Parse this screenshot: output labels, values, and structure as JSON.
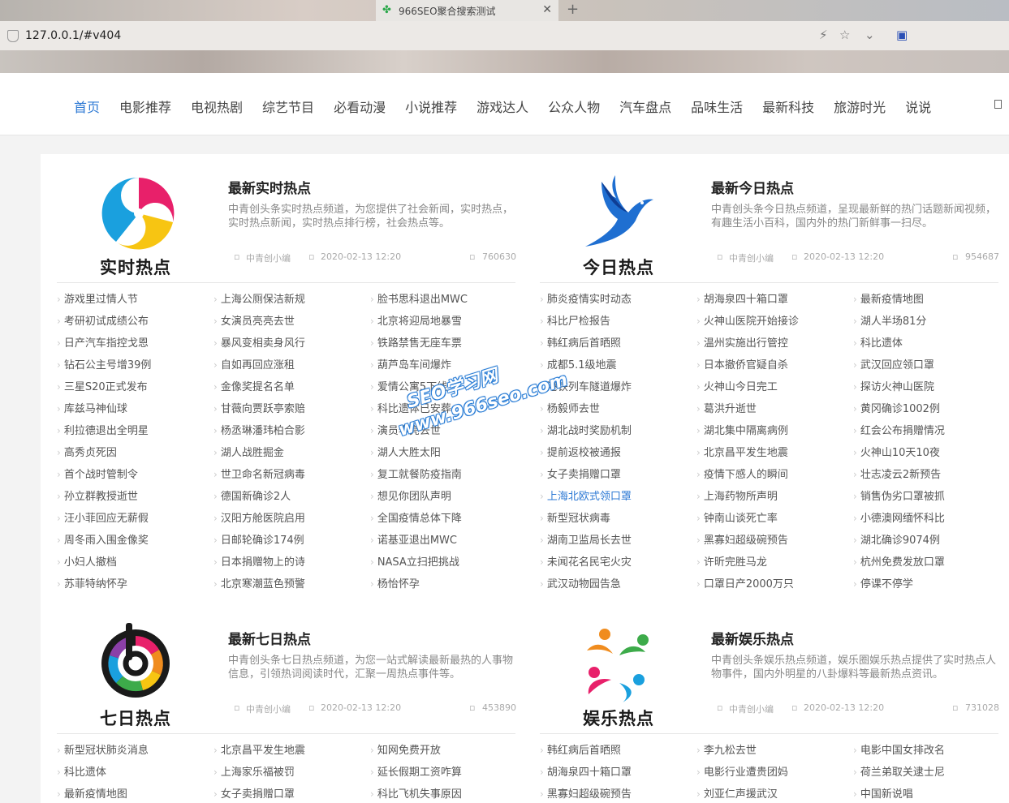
{
  "browser": {
    "tab_title": "966SEO聚合搜索测试",
    "url": "127.0.0.1/#v404"
  },
  "nav": {
    "items": [
      "首页",
      "电影推荐",
      "电视热剧",
      "综艺节目",
      "必看动漫",
      "小说推荐",
      "游戏达人",
      "公众人物",
      "汽车盘点",
      "品味生活",
      "最新科技",
      "旅游时光",
      "说说"
    ],
    "active": "首页"
  },
  "watermark": [
    "SEO学习网",
    "www.966seo.com"
  ],
  "blocks": [
    {
      "logo_text": "实时热点",
      "title": "最新实时热点",
      "desc": "中青创头条实时热点频道，为您提供了社会新闻，实时热点，实时热点新闻，实时热点排行榜，社会热点等。",
      "author": "中青创小编",
      "date": "2020-02-13 12:20",
      "views": "760630",
      "links": [
        [
          "游戏里过情人节",
          "上海公厕保洁新规",
          "脸书思科退出MWC"
        ],
        [
          "考研初试成绩公布",
          "女演员亮亮去世",
          "北京将迎局地暴雪"
        ],
        [
          "日产汽车指控戈恩",
          "暴风变相卖身风行",
          "铁路禁售无座车票"
        ],
        [
          "钻石公主号增39例",
          "自如再回应涨租",
          "葫芦岛车间爆炸"
        ],
        [
          "三星S20正式发布",
          "金像奖提名名单",
          "爱情公寓5下线"
        ],
        [
          "库兹马神仙球",
          "甘薇向贾跃亭索赔",
          "科比遗体已安葬"
        ],
        [
          "利拉德退出全明星",
          "杨丞琳潘玮柏合影",
          "演员李亮去世"
        ],
        [
          "高秀贞死因",
          "湖人战胜掘金",
          "湖人大胜太阳"
        ],
        [
          "首个战时管制令",
          "世卫命名新冠病毒",
          "复工就餐防疫指南"
        ],
        [
          "孙立群教授逝世",
          "德国新确诊2人",
          "想见你团队声明"
        ],
        [
          "汪小菲回应无薪假",
          "汉阳方舱医院启用",
          "全国疫情总体下降"
        ],
        [
          "周冬雨入围金像奖",
          "日邮轮确诊174例",
          "诺基亚退出MWC"
        ],
        [
          "小妇人撤档",
          "日本捐赠物上的诗",
          "NASA立扫把挑战"
        ],
        [
          "苏菲特纳怀孕",
          "北京寒潮蓝色预警",
          "杨怡怀孕"
        ]
      ]
    },
    {
      "logo_text": "今日热点",
      "title": "最新今日热点",
      "desc": "中青创头条今日热点频道，呈现最新鲜的热门话题新闻视频，有趣生活小百科，国内外的热门新鲜事一扫尽。",
      "author": "中青创小编",
      "date": "2020-02-13 12:20",
      "views": "954687",
      "links": [
        [
          "肺炎疫情实时动态",
          "胡海泉四十箱口罩",
          "最新疫情地图"
        ],
        [
          "科比尸检报告",
          "火神山医院开始接诊",
          "湖人半场81分"
        ],
        [
          "韩红病后首晒照",
          "温州实施出行管控",
          "科比遗体"
        ],
        [
          "成都5.1级地震",
          "日本撤侨官疑自杀",
          "武汉回应领口罩"
        ],
        [
          "港铁列车隧道爆炸",
          "火神山今日完工",
          "探访火神山医院"
        ],
        [
          "杨毅师去世",
          "葛洪升逝世",
          "黄冈确诊1002例"
        ],
        [
          "湖北战时奖励机制",
          "湖北集中隔离病例",
          "红会公布捐赠情况"
        ],
        [
          "提前返校被通报",
          "北京昌平发生地震",
          "火神山10天10夜"
        ],
        [
          "女子卖捐赠口罩",
          "疫情下感人的瞬间",
          "壮志凌云2新预告"
        ],
        [
          "上海北欧式领口罩",
          "上海药物所声明",
          "销售伪劣口罩被抓"
        ],
        [
          "新型冠状病毒",
          "钟南山谈死亡率",
          "小德澳网缅怀科比"
        ],
        [
          "湖南卫监局长去世",
          "黑寡妇超级碗预告",
          "湖北确诊9074例"
        ],
        [
          "未闻花名民宅火灾",
          "许昕完胜马龙",
          "杭州免费发放口罩"
        ],
        [
          "武汉动物园告急",
          "口罩日产2000万只",
          "停课不停学"
        ]
      ],
      "highlight": "上海北欧式领口罩"
    },
    {
      "logo_text": "七日热点",
      "title": "最新七日热点",
      "desc": "中青创头条七日热点频道，为您一站式解读最新最热的人事物信息，引领热词阅读时代，汇聚一周热点事件等。",
      "author": "中青创小编",
      "date": "2020-02-13 12:20",
      "views": "453890",
      "links": [
        [
          "新型冠状肺炎消息",
          "北京昌平发生地震",
          "知网免费开放"
        ],
        [
          "科比遗体",
          "上海家乐福被罚",
          "延长假期工资咋算"
        ],
        [
          "最新疫情地图",
          "女子卖捐赠口罩",
          "科比飞机失事原因"
        ]
      ]
    },
    {
      "logo_text": "娱乐热点",
      "title": "最新娱乐热点",
      "desc": "中青创头条娱乐热点频道，娱乐圈娱乐热点提供了实时热点人物事件，国内外明星的八卦爆料等最新热点资讯。",
      "author": "中青创小编",
      "date": "2020-02-13 12:20",
      "views": "731028",
      "links": [
        [
          "韩红病后首晒照",
          "李九松去世",
          "电影中国女排改名"
        ],
        [
          "胡海泉四十箱口罩",
          "电影行业遭贵团妈",
          "荷兰弟取关逮士尼"
        ],
        [
          "黑寡妇超级碗预告",
          "刘亚仁声援武汉",
          "中国新说唱"
        ]
      ]
    }
  ]
}
